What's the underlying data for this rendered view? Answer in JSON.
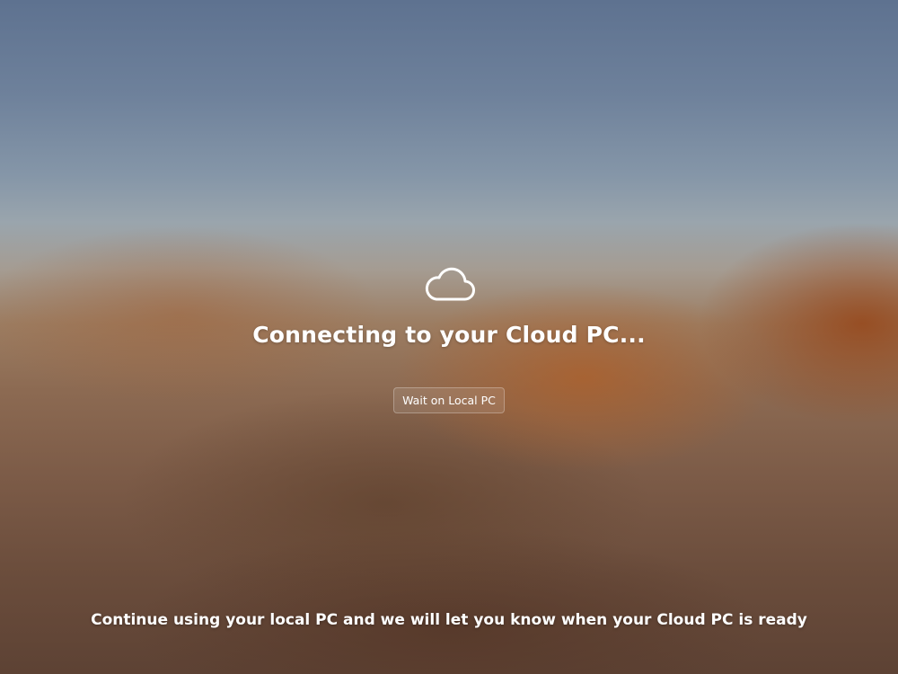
{
  "screen": {
    "icon": "cloud-icon",
    "title": "Connecting to your Cloud PC...",
    "wait_button_label": "Wait on Local PC",
    "footer_message": "Continue using your local PC and we will let you know when your Cloud PC is ready"
  },
  "colors": {
    "text": "#ffffff",
    "sky_top": "#5e7290",
    "ground": "#8c6a52"
  }
}
